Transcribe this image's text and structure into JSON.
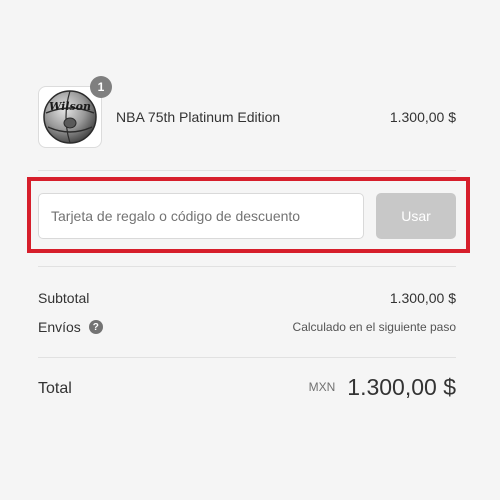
{
  "product": {
    "name": "NBA 75th Platinum Edition",
    "price": "1.300,00 $",
    "quantity": "1",
    "image_icon": "basketball-icon",
    "brand_text": "Wilson"
  },
  "discount": {
    "placeholder": "Tarjeta de regalo o código de descuento",
    "value": "",
    "apply_label": "Usar"
  },
  "summary": {
    "subtotal_label": "Subtotal",
    "subtotal_value": "1.300,00 $",
    "shipping_label": "Envíos",
    "shipping_help_icon": "question-icon",
    "shipping_value": "Calculado en el siguiente paso"
  },
  "total": {
    "label": "Total",
    "currency": "MXN",
    "value": "1.300,00 $"
  },
  "colors": {
    "background": "#f5f5f5",
    "highlight_border": "#d61e2b",
    "button_disabled": "#c8c8c8",
    "badge": "#7f7f7f",
    "divider": "#e1e1e1"
  }
}
